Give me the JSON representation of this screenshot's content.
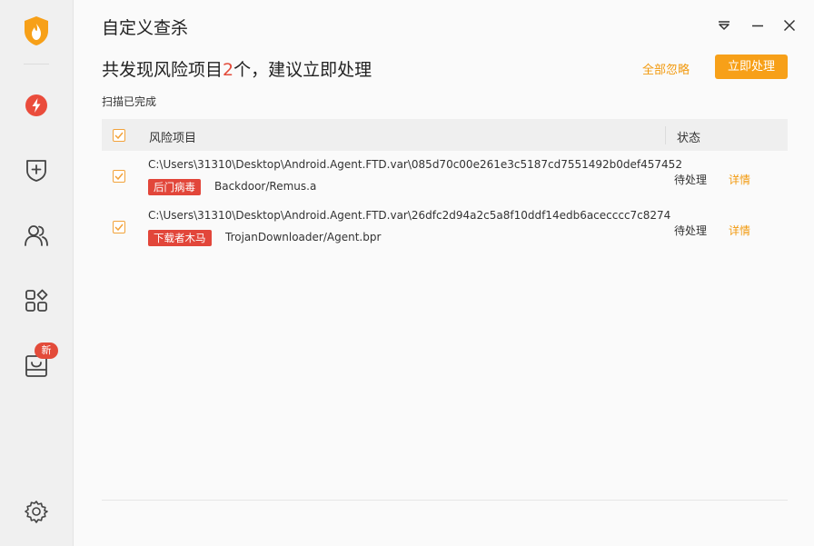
{
  "window": {
    "title": "自定义查杀"
  },
  "header": {
    "headline_prefix": "共发现风险项目",
    "risk_count": "2",
    "headline_suffix": "个，建议立即处理",
    "ignore_all_label": "全部忽略",
    "fix_now_label": "立即处理",
    "scan_status": "扫描已完成"
  },
  "table": {
    "col_item": "风险项目",
    "col_status": "状态",
    "rows": [
      {
        "path": "C:\\Users\\31310\\Desktop\\Android.Agent.FTD.var\\085d70c00e261e3c5187cd7551492b0def457452",
        "tag": "后门病毒",
        "threat": "Backdoor/Remus.a",
        "status": "待处理",
        "detail": "详情"
      },
      {
        "path": "C:\\Users\\31310\\Desktop\\Android.Agent.FTD.var\\26dfc2d94a2c5a8f10ddf14edb6acecccc7c8274",
        "tag": "下载者木马",
        "threat": "TrojanDownloader/Agent.bpr",
        "status": "待处理",
        "detail": "详情"
      }
    ]
  },
  "sidebar": {
    "items": [
      "logo-icon",
      "lightning-icon",
      "shield-plus-icon",
      "users-icon",
      "apps-icon",
      "toolbox-icon",
      "settings-icon"
    ],
    "new_badge": "新"
  },
  "colors": {
    "accent": "#f7a018",
    "danger": "#e34b3a"
  }
}
